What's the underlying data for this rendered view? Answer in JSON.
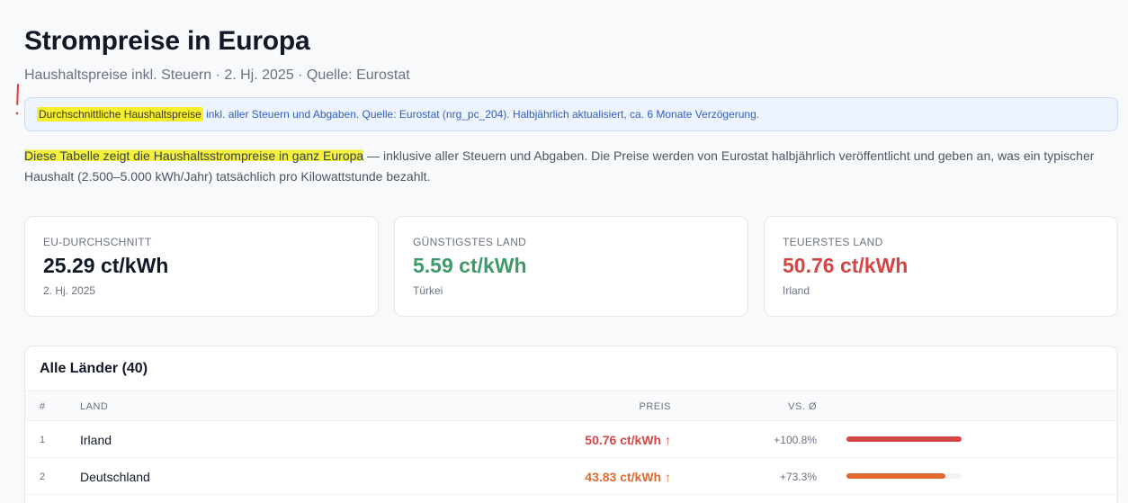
{
  "header": {
    "title": "Strompreise in Europa",
    "subtitle": "Haushaltspreise inkl. Steuern · 2. Hj. 2025 · Quelle: Eurostat"
  },
  "info_box": {
    "highlight": "Durchschnittliche Haushaltspreise",
    "rest": " inkl. aller Steuern und Abgaben. Quelle: Eurostat (nrg_pc_204). Halbjährlich aktualisiert, ca. 6 Monate Verzögerung."
  },
  "intro": {
    "highlight": "Diese Tabelle zeigt die Haushaltsstrompreise in ganz Europa",
    "rest": " — inklusive aller Steuern und Abgaben. Die Preise werden von Eurostat halbjährlich veröffentlicht und geben an, was ein typischer Haushalt (2.500–5.000 kWh/Jahr) tatsächlich pro Kilowattstunde bezahlt."
  },
  "cards": [
    {
      "label": "EU-DURCHSCHNITT",
      "value": "25.29 ct/kWh",
      "sub": "2. Hj. 2025",
      "color": "#111827"
    },
    {
      "label": "GÜNSTIGSTES LAND",
      "value": "5.59 ct/kWh",
      "sub": "Türkei",
      "color": "#3f9a6a"
    },
    {
      "label": "TEUERSTES LAND",
      "value": "50.76 ct/kWh",
      "sub": "Irland",
      "color": "#d64545"
    }
  ],
  "table": {
    "title": "Alle Länder (40)",
    "headers": {
      "rank": "#",
      "land": "LAND",
      "price": "PREIS",
      "vs": "VS. Ø"
    },
    "rows": [
      {
        "rank": "1",
        "land": "Irland",
        "price": "50.76 ct/kWh ↑",
        "vs": "+100.8%",
        "color": "#d64545",
        "level": 1.0
      },
      {
        "rank": "2",
        "land": "Deutschland",
        "price": "43.83 ct/kWh ↑",
        "vs": "+73.3%",
        "color": "#e0692e",
        "level": 0.863
      }
    ]
  },
  "colors": {
    "info_bg": "#eef4fd",
    "info_text": "#2f5fc6",
    "highlight": "#f5ef2f",
    "annotation_mark": "#e53935"
  }
}
